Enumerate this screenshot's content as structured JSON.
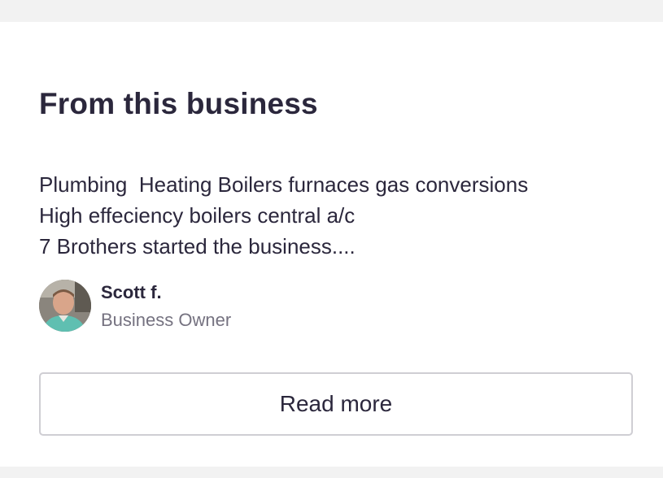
{
  "section": {
    "title": "From this business",
    "description": "Plumbing  Heating Boilers furnaces gas conversions\nHigh effeciency boilers central a/c\n7 Brothers started the business...."
  },
  "owner": {
    "name": "Scott f.",
    "role": "Business Owner",
    "avatar_icon": "person-photo"
  },
  "actions": {
    "read_more_label": "Read more"
  },
  "colors": {
    "text_primary": "#2b273c",
    "text_secondary": "#757280",
    "border": "#cfced3",
    "page_background": "#f2f2f2"
  }
}
